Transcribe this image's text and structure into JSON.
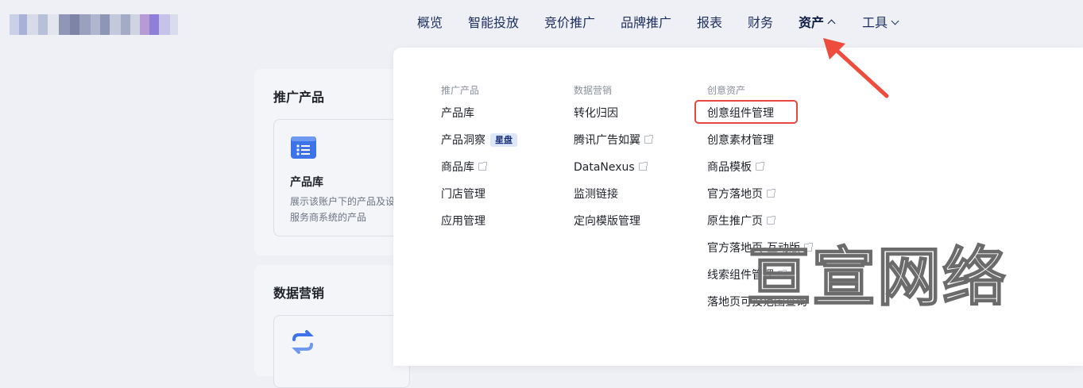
{
  "nav": {
    "items": [
      {
        "label": "概览"
      },
      {
        "label": "智能投放"
      },
      {
        "label": "竞价推广"
      },
      {
        "label": "品牌推广"
      },
      {
        "label": "报表"
      },
      {
        "label": "财务"
      },
      {
        "label": "资产",
        "active": true,
        "expanded": true
      },
      {
        "label": "工具",
        "expanded": false
      }
    ]
  },
  "cards": {
    "promo": {
      "title": "推广产品",
      "product_lib": {
        "title": "产品库",
        "desc_line1": "展示该账户下的产品及设",
        "desc_line2": "服务商系统的产品",
        "icon": "list-icon"
      }
    },
    "data": {
      "title": "数据营销",
      "icon": "sync-arrows-icon"
    }
  },
  "dropdown": {
    "col1": {
      "title": "推广产品",
      "items": [
        "产品库",
        "产品洞察",
        "商品库",
        "门店管理",
        "应用管理"
      ],
      "badge": "星盘"
    },
    "col2": {
      "title": "数据营销",
      "items": [
        "转化归因",
        "腾讯广告如翼",
        "DataNexus",
        "监测链接",
        "定向模版管理"
      ]
    },
    "col3": {
      "title": "创意资产",
      "items": [
        "创意组件管理",
        "创意素材管理",
        "商品模板",
        "官方落地页",
        "原生推广页",
        "官方落地页-互动版",
        "线索组件管理",
        "落地页可投范围查询"
      ]
    }
  },
  "watermark": "亘宣网络",
  "colors": {
    "accent": "#e8473f",
    "nav_text": "#1f2f61",
    "badge_bg": "#dde7fb",
    "icon_blue": "#3d73e8"
  }
}
